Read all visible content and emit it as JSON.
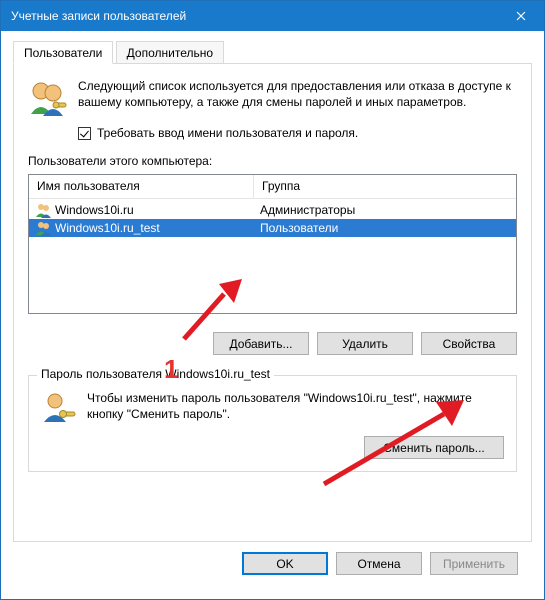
{
  "window": {
    "title": "Учетные записи пользователей"
  },
  "tabs": {
    "users": "Пользователи",
    "advanced": "Дополнительно"
  },
  "intro": {
    "text": "Следующий список используется для предоставления или отказа в доступе к вашему компьютеру, а также для смены паролей и иных параметров."
  },
  "checkbox": {
    "label": "Требовать ввод имени пользователя и пароля.",
    "checked": true
  },
  "users_list": {
    "label": "Пользователи этого компьютера:",
    "columns": {
      "name": "Имя пользователя",
      "group": "Группа"
    },
    "rows": [
      {
        "name": "Windows10i.ru",
        "group": "Администраторы",
        "selected": false
      },
      {
        "name": "Windows10i.ru_test",
        "group": "Пользователи",
        "selected": true
      }
    ]
  },
  "buttons": {
    "add": "Добавить...",
    "remove": "Удалить",
    "properties": "Свойства"
  },
  "password_group": {
    "legend": "Пароль пользователя Windows10i.ru_test",
    "message": "Чтобы изменить пароль пользователя \"Windows10i.ru_test\", нажмите кнопку \"Сменить пароль\".",
    "button": "Сменить пароль..."
  },
  "dialog": {
    "ok": "OK",
    "cancel": "Отмена",
    "apply": "Применить"
  },
  "annotation": {
    "marker": "1"
  }
}
